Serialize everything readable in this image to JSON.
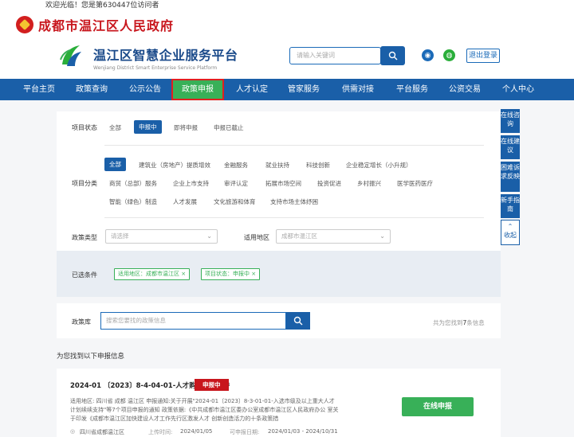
{
  "topbar": {
    "welcome": "欢迎光临！您是第630447位访问者"
  },
  "gov": {
    "title": "成都市温江区人民政府"
  },
  "brand": {
    "title": "温江区智慧企业服务平台",
    "subtitle": "Wenjiang District Smart Enterprise Service Platform",
    "search_placeholder": "请输入关键词",
    "logout_label": "退出登录"
  },
  "nav": {
    "items": [
      "平台主页",
      "政策查询",
      "公示公告",
      "政策申报",
      "人才认定",
      "管家服务",
      "供需对接",
      "平台服务",
      "公资交易",
      "个人中心"
    ],
    "active": "政策申报"
  },
  "filter": {
    "status_label": "项目状态",
    "status_options": [
      "全部",
      "申报中",
      "即将申报",
      "申报已截止"
    ],
    "status_selected": "申报中",
    "category_label": "项目分类",
    "category_options": [
      "全部",
      "建筑业（房地产）提质增效",
      "金融服务",
      "就业扶持",
      "科技创新",
      "企业稳定增长（小升规）",
      "商贸（总部）服务",
      "企业上市支持",
      "审评认定",
      "拓展市场空间",
      "投资促进",
      "乡村振兴",
      "医学医药医疗",
      "智能（绿色）制造",
      "人才发展",
      "文化旅游和体育",
      "支持市场主体纾困"
    ],
    "category_selected": "全部",
    "policy_type_label": "政策类型",
    "policy_type_placeholder": "请选择",
    "region_label": "适用地区",
    "region_value": "成都市温江区"
  },
  "chosen": {
    "label": "已选条件",
    "chips": [
      "适用地区：成都市温江区",
      "项目状态：申报中"
    ]
  },
  "policy_search": {
    "label": "政策库",
    "placeholder": "搜索您要找的政策信息",
    "count_prefix": "共为您找到",
    "count": "7",
    "count_suffix": "条信息"
  },
  "found_text": "为您找到以下申报信息",
  "result": {
    "title": "2024-01 〔2023〕8-4-04-01-人才购房补贴支持",
    "badge": "申报中",
    "description": "适用地区: 四川省 成都 温江区 申报通知:关于开展\"2024-01〔2023〕8-3-01-01-入选市级及以上重大人才计划续续支持\"等7个项目申报的通知 政策依据:《中共成都市温江区委办公室成都市温江区人民政府办公 室关于印发《成都市温江区加快建设人才工作先行区激发人才 创新创造活力的十条政策措",
    "apply_label": "在线申报",
    "location": "四川省成都温江区",
    "publish_label": "上传时间:",
    "publish_date": "2024/01/05",
    "period_label": "可申报日期:",
    "period": "2024/01/03 - 2024/10/31"
  },
  "sidebar": {
    "items": [
      "在线咨询",
      "在线建议",
      "困难诉求反映",
      "新手指南"
    ],
    "collapse_label": "收起"
  },
  "colors": {
    "primary": "#1a5fa8",
    "accent_green": "#38b058",
    "brand_red": "#c8161d"
  }
}
